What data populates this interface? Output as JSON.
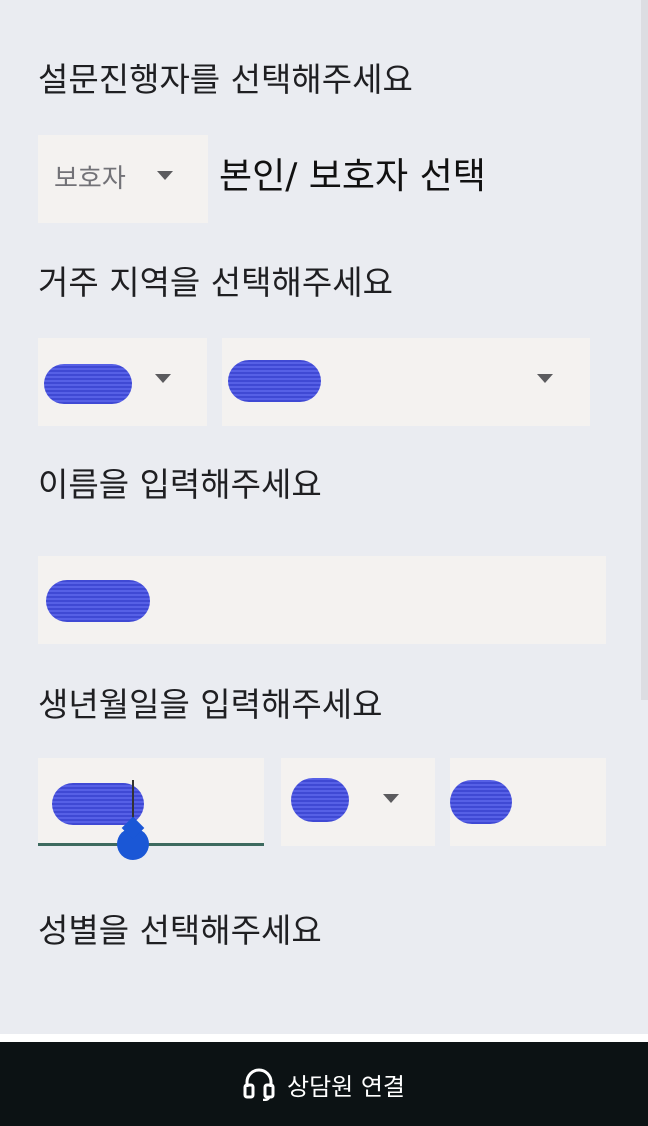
{
  "sections": {
    "respondent": {
      "label": "설문진행자를 선택해주세요",
      "select_value": "보호자",
      "hint": "본인/ 보호자 선택"
    },
    "region": {
      "label": "거주 지역을 선택해주세요"
    },
    "name": {
      "label": "이름을 입력해주세요"
    },
    "birth": {
      "label": "생년월일을 입력해주세요"
    },
    "gender": {
      "label": "성별을 선택해주세요"
    }
  },
  "bottom_bar": {
    "label": "상담원 연결",
    "icon": "headset-icon"
  },
  "colors": {
    "background": "#eaecf1",
    "field": "#f4f2f0",
    "bottom_bar": "#0c1214",
    "redaction": "#3f49d4",
    "cursor_handle": "#1a57d6",
    "focus_underline": "#3d6a5f"
  }
}
